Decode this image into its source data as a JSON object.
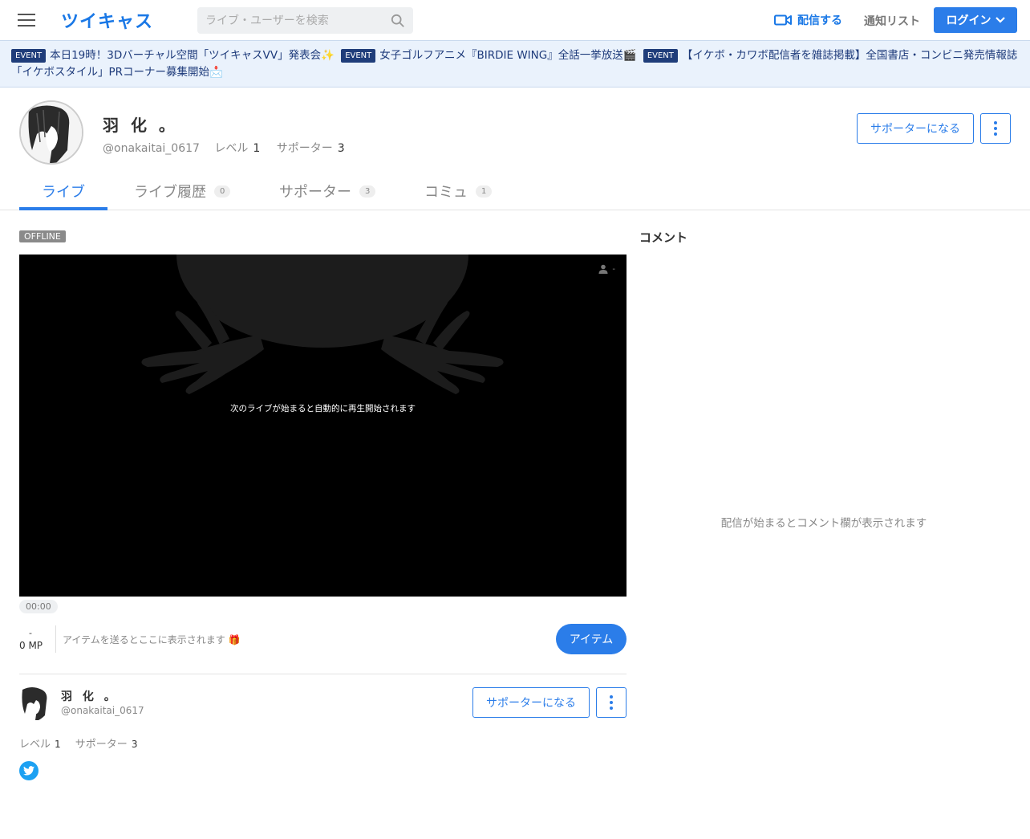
{
  "header": {
    "logo": "ツイキャス",
    "search_placeholder": "ライブ・ユーザーを検索",
    "broadcast_label": "配信する",
    "notify_label": "通知リスト",
    "login_label": "ログイン"
  },
  "banner": {
    "badge": "EVENT",
    "events": [
      "本日19時！3Dバーチャル空間「ツイキャスVV」発表会✨",
      "女子ゴルフアニメ『BIRDIE WING』全話一挙放送🎬",
      "【イケボ・カワボ配信者を雑誌掲載】全国書店・コンビニ発売情報誌「イケボスタイル」PRコーナー募集開始📩"
    ]
  },
  "profile": {
    "name": "羽 化 。",
    "handle": "@onakaitai_0617",
    "level_label": "レベル",
    "level": "1",
    "supporter_label": "サポーター",
    "supporters": "3",
    "become_supporter": "サポーターになる"
  },
  "tabs": [
    {
      "label": "ライブ",
      "count": ""
    },
    {
      "label": "ライブ履歴",
      "count": "0"
    },
    {
      "label": "サポーター",
      "count": "3"
    },
    {
      "label": "コミュ",
      "count": "1"
    }
  ],
  "player": {
    "status": "OFFLINE",
    "message": "次のライブが始まると自動的に再生開始されます",
    "viewers": "-",
    "time": "00:00"
  },
  "items": {
    "mp_dash": "-",
    "mp_value": "0 MP",
    "placeholder": "アイテムを送るとここに表示されます 🎁",
    "button": "アイテム"
  },
  "comments": {
    "title": "コメント",
    "empty": "配信が始まるとコメント欄が表示されます"
  },
  "colors": {
    "accent": "#2b7de9",
    "banner_bg": "#eaf2fc",
    "twitter": "#1da1f2"
  }
}
